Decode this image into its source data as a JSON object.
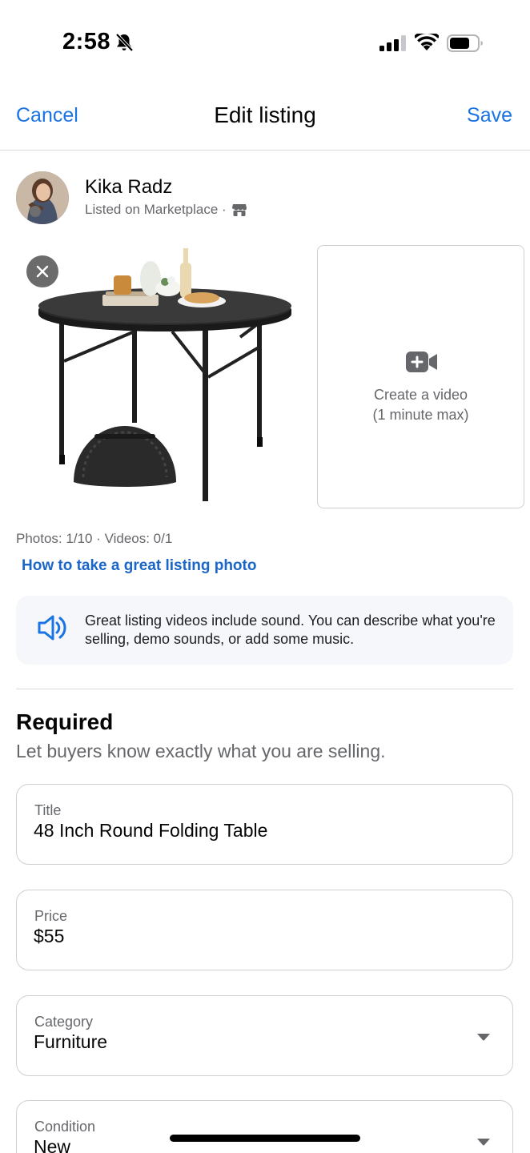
{
  "status_bar": {
    "time": "2:58"
  },
  "nav": {
    "cancel_label": "Cancel",
    "title": "Edit listing",
    "save_label": "Save"
  },
  "profile": {
    "name": "Kika Radz",
    "subtitle": "Listed on Marketplace ·"
  },
  "media": {
    "create_video_line1": "Create a video",
    "create_video_line2": "(1 minute max)",
    "count_text": "Photos: 1/10 · Videos: 0/1",
    "photo_tip_link": "How to take a great listing photo"
  },
  "info": {
    "text": "Great listing videos include sound. You can describe what you're selling, demo sounds, or add some music."
  },
  "required": {
    "title": "Required",
    "subtitle": "Let buyers know exactly what you are selling."
  },
  "fields": {
    "title": {
      "label": "Title",
      "value": "48 Inch Round Folding Table"
    },
    "price": {
      "label": "Price",
      "value": "$55"
    },
    "category": {
      "label": "Category",
      "value": "Furniture"
    },
    "condition": {
      "label": "Condition",
      "value": "New"
    }
  },
  "colors": {
    "accent": "#1b74e4",
    "link": "#1b66c9",
    "muted": "#65676b",
    "border": "#ccd0d5"
  }
}
